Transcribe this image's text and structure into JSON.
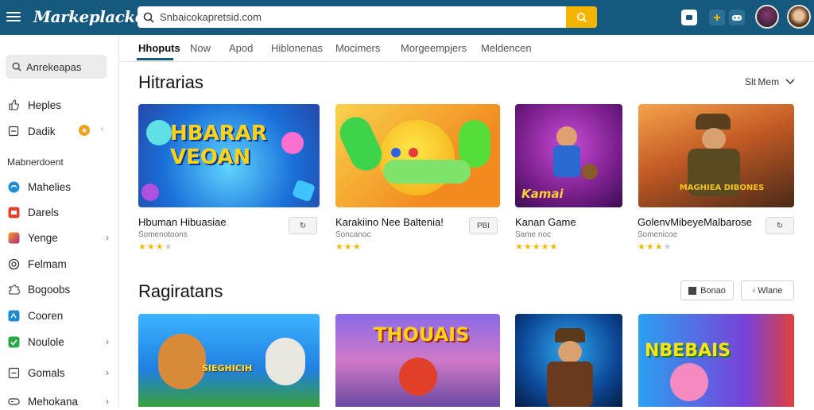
{
  "header": {
    "logo": "Markeplacke",
    "search_value": "Snbaicokapretsid.com"
  },
  "sidebar": {
    "search_label": "Anrekeapas",
    "items_top": [
      {
        "label": "Heples",
        "icon": "thumbs-up-icon"
      },
      {
        "label": "Dadik",
        "icon": "square-icon",
        "badge": "★"
      }
    ],
    "heading": "Mabnerdoent",
    "items": [
      {
        "label": "Mahelies",
        "icon": "blue-circle-icon",
        "color": "#1e8fd6"
      },
      {
        "label": "Darels",
        "icon": "red-square-icon",
        "color": "#e0452b"
      },
      {
        "label": "Yenge",
        "icon": "gradient-square-icon",
        "color": "#c2338c",
        "chevron": true
      },
      {
        "label": "Felmam",
        "icon": "ring-icon"
      },
      {
        "label": "Bogoobs",
        "icon": "puzzle-icon"
      },
      {
        "label": "Cooren",
        "icon": "blue-square-icon",
        "color": "#1f8ad0"
      },
      {
        "label": "Noulole",
        "icon": "green-check-icon",
        "color": "#2aa84a",
        "chevron": true
      },
      {
        "label": "Gomals",
        "icon": "box-icon",
        "chevron": true
      },
      {
        "label": "Mehokana",
        "icon": "gamepad-icon",
        "chevron": true
      }
    ]
  },
  "tabs": [
    "Hhoputs",
    "Now",
    "Apod",
    "Hiblonenas",
    "Mocimers",
    "Morgeempjers",
    "Meldencen"
  ],
  "sections": {
    "first_title": "Hitrarias",
    "sort_label": "Slt Mem",
    "second_title": "Ragiratans",
    "second_buttons": [
      "Bonao",
      "Wlane"
    ]
  },
  "cards": [
    {
      "title": "Hbuman Hibuasiae",
      "sub": "Somenotoons",
      "stars": 3,
      "button": "↻",
      "art_text": "HBARAR VEOAN"
    },
    {
      "title": "Karakiino Nee Baltenia!",
      "sub": "Soncanoc",
      "stars": 3,
      "button": "PBI",
      "art_text": ""
    },
    {
      "title": "Kanan Game",
      "sub": "Same noc",
      "stars": 5,
      "button": "",
      "art_text": "Kamai"
    },
    {
      "title": "GolenvMibeyeMalbarose",
      "sub": "Somenicoe",
      "stars": 3,
      "button": "↻",
      "art_text": "MAGHIEA DIBONES"
    }
  ],
  "cards_row2_art": [
    "SIEGHICIH",
    "THOUAIS",
    "",
    "NBEBAIS"
  ],
  "colors": {
    "brand": "#155a7e",
    "accent": "#f4b400"
  }
}
